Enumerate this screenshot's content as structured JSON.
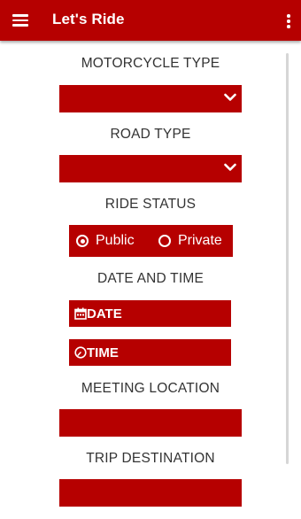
{
  "app_bar": {
    "title": "Let's Ride",
    "menu_icon": "hamburger-menu-icon",
    "overflow_icon": "more-vert-icon",
    "color": "#b60000"
  },
  "form": {
    "motorcycle_type": {
      "label": "MOTORCYCLE TYPE",
      "selected": ""
    },
    "road_type": {
      "label": "ROAD TYPE",
      "selected": ""
    },
    "ride_status": {
      "label": "RIDE STATUS",
      "options": [
        {
          "label": "Public",
          "checked": true
        },
        {
          "label": "Private",
          "checked": false
        }
      ]
    },
    "date_time": {
      "label": "DATE AND TIME",
      "date_button": "DATE",
      "time_button": "TIME"
    },
    "meeting_location": {
      "label": "MEETING LOCATION",
      "value": ""
    },
    "trip_destination": {
      "label": "TRIP DESTINATION",
      "value": ""
    }
  },
  "colors": {
    "accent": "#b60000",
    "text": "#333333",
    "background": "#ffffff"
  }
}
